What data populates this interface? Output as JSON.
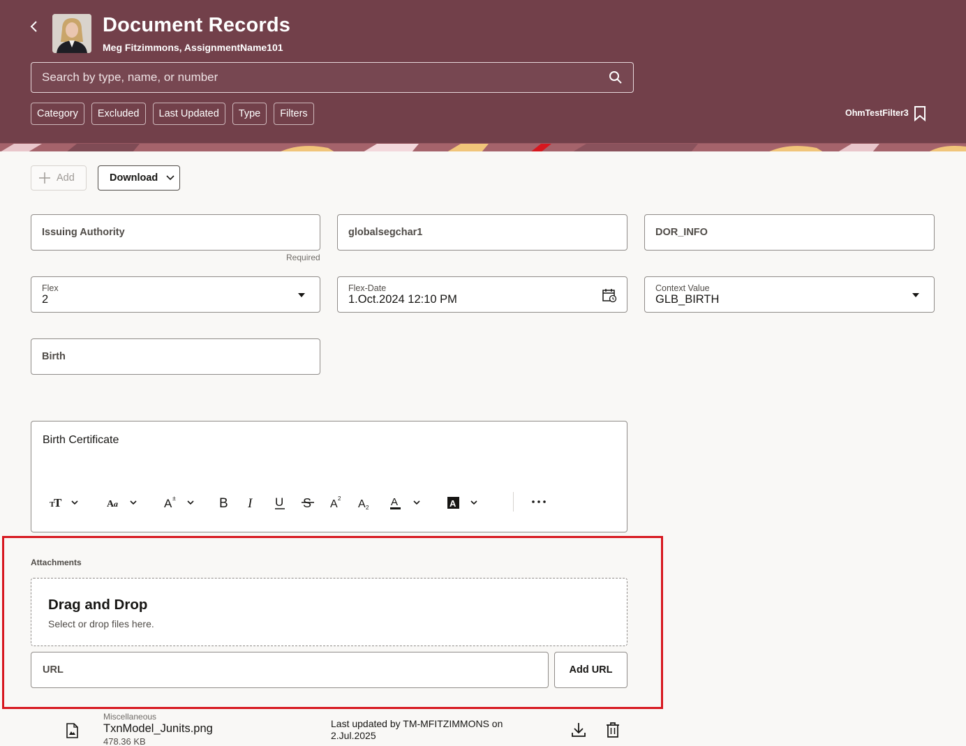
{
  "header": {
    "title": "Document Records",
    "subtitle": "Meg Fitzimmons, AssignmentName101",
    "search_placeholder": "Search by type, name, or number",
    "filter_chips": [
      "Category",
      "Excluded",
      "Last Updated",
      "Type",
      "Filters"
    ],
    "saved_filter": "OhmTestFilter3"
  },
  "toolbar": {
    "add_label": "Add",
    "download_label": "Download"
  },
  "form": {
    "issuing_authority": "Issuing Authority",
    "required_note": "Required",
    "globalsegchar1": "globalsegchar1",
    "dor_info": "DOR_INFO",
    "flex": {
      "label": "Flex",
      "value": "2"
    },
    "flex_date": {
      "label": "Flex-Date",
      "value": "1.Oct.2024 12:10 PM"
    },
    "context_value": {
      "label": "Context Value",
      "value": "GLB_BIRTH"
    },
    "birth": "Birth"
  },
  "rich_text": {
    "content": "Birth Certificate",
    "tools": [
      "text-style",
      "font",
      "font-size",
      "bold",
      "italic",
      "underline",
      "strikethrough",
      "superscript",
      "subscript",
      "font-color",
      "highlight-color",
      "more"
    ]
  },
  "attachments": {
    "label": "Attachments",
    "drop_title": "Drag and Drop",
    "drop_subtitle": "Select or drop files here.",
    "url_placeholder": "URL",
    "add_url_label": "Add URL",
    "files": [
      {
        "category": "Miscellaneous",
        "name": "TxnModel_Junits.png",
        "size": "478.36 KB",
        "updated_line1": "Last updated by TM-MFITZIMMONS on",
        "updated_line2": "2.Jul.2025"
      }
    ]
  },
  "colors": {
    "header_bg": "#72404a",
    "highlight_border": "#d7171f",
    "page_bg": "#f9f8f6"
  }
}
